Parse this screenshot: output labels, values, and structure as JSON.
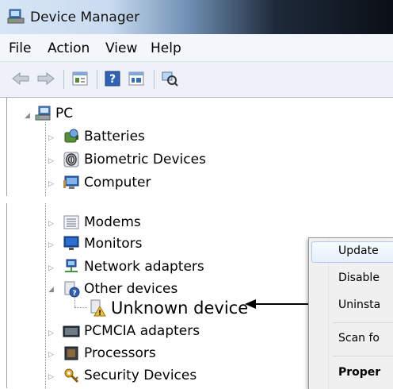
{
  "window": {
    "title": "Device Manager"
  },
  "menu": [
    "File",
    "Action",
    "View",
    "Help"
  ],
  "toolbar": {
    "buttons": [
      "back-arrow-icon",
      "forward-arrow-icon",
      "properties-icon",
      "help-icon",
      "update-driver-icon",
      "scan-hardware-icon"
    ]
  },
  "tree": {
    "root": "PC",
    "items": [
      "Batteries",
      "Biometric Devices",
      "Computer",
      "Modems",
      "Monitors",
      "Network adapters",
      "Other devices",
      "PCMCIA adapters",
      "Processors",
      "Security Devices"
    ],
    "child": "Unknown device"
  },
  "context_menu": {
    "items": [
      "Update",
      "Disable",
      "Uninsta",
      "Scan fo",
      "Proper"
    ]
  },
  "colors": {
    "title_gradient_dark": "#0b0f16",
    "menu_bg": "#f3f6fb",
    "warning_yellow": "#f2c12e"
  }
}
